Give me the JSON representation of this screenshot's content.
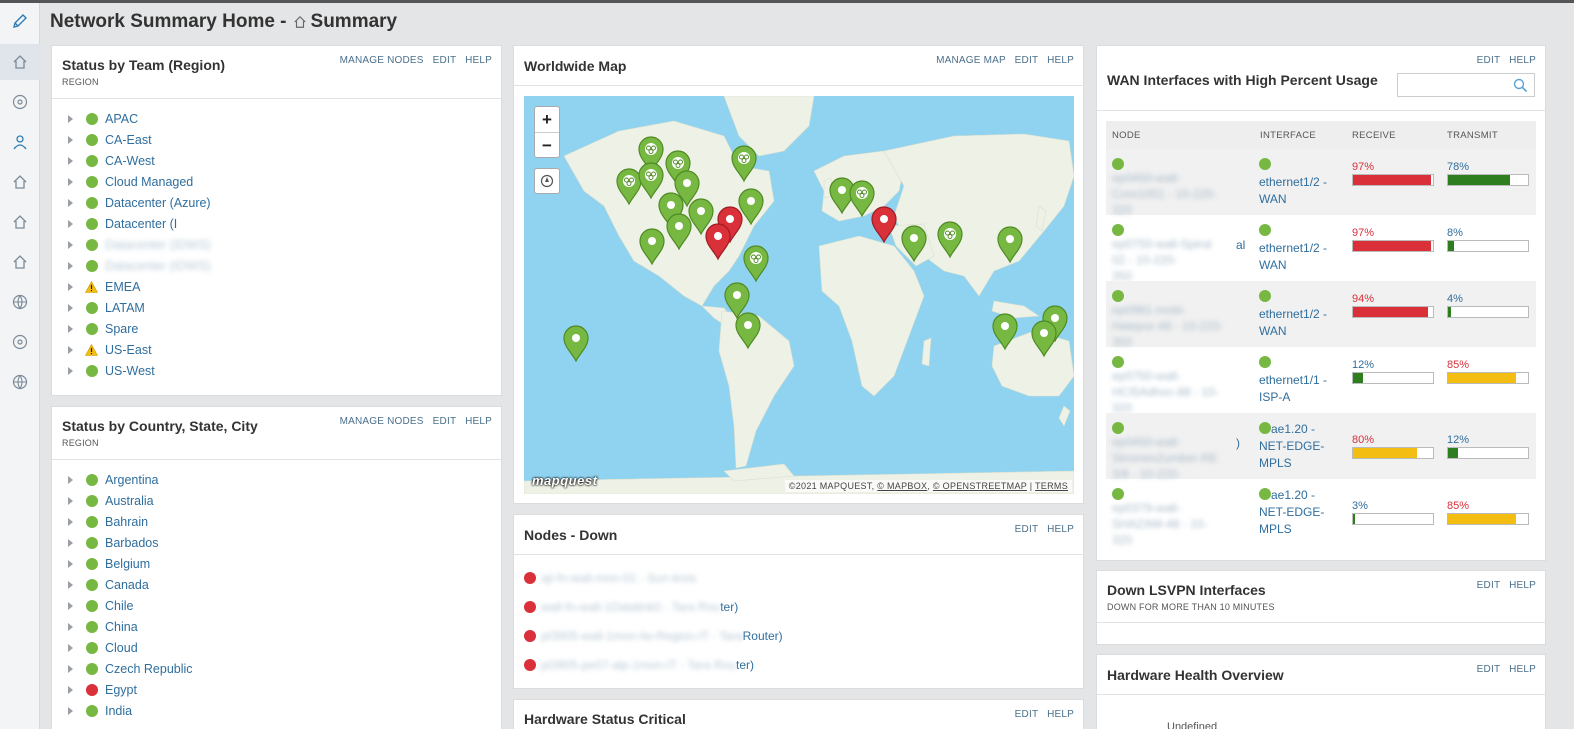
{
  "page": {
    "title": "Network Summary Home -",
    "breadcrumb": "Summary"
  },
  "sidebar": {
    "items": [
      "edit-icon",
      "home-icon",
      "network-icon",
      "user-icon",
      "home-icon",
      "home-icon",
      "home-icon",
      "globe-icon",
      "network-icon",
      "globe-icon"
    ]
  },
  "team_panel": {
    "title": "Status by Team (Region)",
    "subtitle": "REGION",
    "actions": [
      "MANAGE NODES",
      "EDIT",
      "HELP"
    ],
    "items": [
      {
        "label": "APAC",
        "status": "green"
      },
      {
        "label": "CA-East",
        "status": "green"
      },
      {
        "label": "CA-West",
        "status": "green"
      },
      {
        "label": "Cloud Managed",
        "status": "green"
      },
      {
        "label": "Datacenter (Azure)",
        "status": "green"
      },
      {
        "label": "Datacenter (I",
        "status": "green"
      },
      {
        "label": "Datacenter (IDWS)",
        "status": "green"
      },
      {
        "label": "Datacenter (IDWS)",
        "status": "green"
      },
      {
        "label": "EMEA",
        "status": "warning"
      },
      {
        "label": "LATAM",
        "status": "green"
      },
      {
        "label": "Spare",
        "status": "green"
      },
      {
        "label": "US-East",
        "status": "warning"
      },
      {
        "label": "US-West",
        "status": "green"
      }
    ]
  },
  "country_panel": {
    "title": "Status by Country, State, City",
    "subtitle": "REGION",
    "actions": [
      "MANAGE NODES",
      "EDIT",
      "HELP"
    ],
    "items": [
      {
        "label": "Argentina",
        "status": "green"
      },
      {
        "label": "Australia",
        "status": "green"
      },
      {
        "label": "Bahrain",
        "status": "green"
      },
      {
        "label": "Barbados",
        "status": "green"
      },
      {
        "label": "Belgium",
        "status": "green"
      },
      {
        "label": "Canada",
        "status": "green"
      },
      {
        "label": "Chile",
        "status": "green"
      },
      {
        "label": "China",
        "status": "green"
      },
      {
        "label": "Cloud",
        "status": "green"
      },
      {
        "label": "Czech Republic",
        "status": "green"
      },
      {
        "label": "Egypt",
        "status": "red"
      },
      {
        "label": "India",
        "status": "green"
      }
    ]
  },
  "map_panel": {
    "title": "Worldwide Map",
    "actions": [
      "MANAGE MAP",
      "EDIT",
      "HELP"
    ],
    "zoom_in": "+",
    "zoom_out": "−",
    "logo": "mapquest",
    "attribution": {
      "copyright": "©2021 MAPQUEST,",
      "mapbox": "© MAPBOX",
      "osm": "© OPENSTREETMAP",
      "sep": "|",
      "terms": "TERMS"
    }
  },
  "nodes_down_panel": {
    "title": "Nodes - Down",
    "actions": [
      "EDIT",
      "HELP"
    ],
    "rows": [
      {
        "blurred": "aji-fn-wall-mon-01 - Sun-lexis",
        "visible": ""
      },
      {
        "blurred": "wall-fn-wall-1Datalink0 - Tara Rou",
        "visible": "ter)"
      },
      {
        "blurred": "pt3905-wall-1mon-fw-Region-IT - Tara",
        "visible": " Router)"
      },
      {
        "blurred": "pt3905-pe07-alp-1mon-IT - Tara Rou",
        "visible": "ter)"
      }
    ]
  },
  "hw_critical_panel": {
    "title": "Hardware Status Critical",
    "actions": [
      "EDIT",
      "HELP"
    ]
  },
  "wan_panel": {
    "title": "WAN Interfaces with High Percent Usage",
    "actions": [
      "EDIT",
      "HELP"
    ],
    "search_placeholder": "",
    "columns": [
      "NODE",
      "INTERFACE",
      "RECEIVE",
      "TRANSMIT"
    ],
    "rows": [
      {
        "node": [
          "ep0450-wall-",
          "Core1001 - 10-220-",
          "320"
        ],
        "node_tail": "",
        "iface": [
          "ethernet1/2 -",
          "WAN"
        ],
        "receive": "97%",
        "receive_level": "red",
        "receive_fill": 0.97,
        "transmit": "78%",
        "transmit_level": "green",
        "transmit_fill": 0.78
      },
      {
        "node": [
          "ep0750-wall-Spiral",
          "02 - 10-220-",
          "350"
        ],
        "node_tail": "al",
        "iface": [
          "ethernet1/2 -",
          "WAN"
        ],
        "receive": "97%",
        "receive_level": "red",
        "receive_fill": 0.97,
        "transmit": "8%",
        "transmit_level": "green",
        "transmit_fill": 0.08
      },
      {
        "node": [
          "ep0981-mobi-",
          "Halepor-48 - 10-220-",
          "350"
        ],
        "node_tail": "",
        "iface": [
          "ethernet1/2 -",
          "WAN"
        ],
        "receive": "94%",
        "receive_level": "red",
        "receive_fill": 0.94,
        "transmit": "4%",
        "transmit_level": "green",
        "transmit_fill": 0.04
      },
      {
        "node": [
          "ep0750-wall-",
          "HCI5Adhoc-88 - 10-",
          "320"
        ],
        "node_tail": "",
        "iface": [
          "ethernet1/1 -",
          "ISP-A"
        ],
        "receive": "12%",
        "receive_level": "green",
        "receive_fill": 0.12,
        "transmit": "85%",
        "transmit_level": "yellow",
        "transmit_fill": 0.85
      },
      {
        "node": [
          "ep0450-wall-",
          "Stromex2umber-RE",
          "3/8 - 10-220-"
        ],
        "node_tail": ")",
        "iface": [
          "ae1.20 -",
          "NET-EDGE-",
          "MPLS"
        ],
        "receive": "80%",
        "receive_level": "yellow",
        "receive_fill": 0.8,
        "transmit": "12%",
        "transmit_level": "green",
        "transmit_fill": 0.12
      },
      {
        "node": [
          "ep0379-wall-",
          "SHAZAM-48 - 10-",
          "320"
        ],
        "node_tail": "",
        "iface": [
          "ae1.20 -",
          "NET-EDGE-",
          "MPLS"
        ],
        "receive": "3%",
        "receive_level": "green",
        "receive_fill": 0.03,
        "transmit": "85%",
        "transmit_level": "yellow",
        "transmit_fill": 0.85
      }
    ]
  },
  "lsvpn_panel": {
    "title": "Down LSVPN Interfaces",
    "subtitle": "DOWN FOR MORE THAN 10 MINUTES",
    "actions": [
      "EDIT",
      "HELP"
    ]
  },
  "hw_health_panel": {
    "title": "Hardware Health Overview",
    "actions": [
      "EDIT",
      "HELP"
    ],
    "partial_text": "Undefined"
  },
  "colors": {
    "ok": "#77b843",
    "down": "#d9303a",
    "warning": "#f4bd12",
    "link": "#2f6e9e",
    "transmit_ok": "#2e7d1f"
  }
}
